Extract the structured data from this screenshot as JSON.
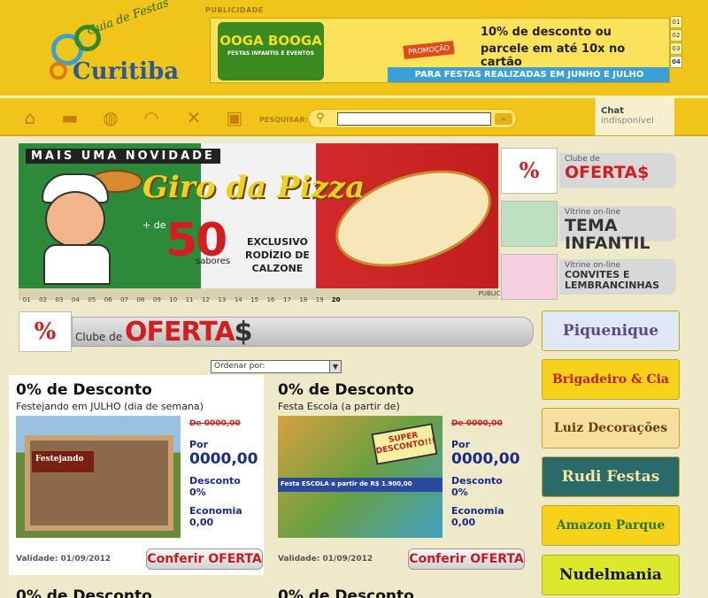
{
  "header": {
    "logo_top": "Guia de Festas",
    "logo_city": "Curitiba",
    "publicidade": "PUBLICIDADE"
  },
  "top_ad": {
    "brand": "OOGA BOOGA",
    "brand_sub": "FESTAS INFANTIS E EVENTOS",
    "promo": "PROMOÇÃO",
    "line1": "10% de desconto ou",
    "line2": "parcele em até 10x no cartão",
    "bottom": "PARA FESTAS REALIZADAS EM JUNHO E JULHO",
    "pages": [
      "01",
      "02",
      "03",
      "04"
    ],
    "active_page": "04"
  },
  "nav": {
    "icons": [
      "home-icon",
      "cake-icon",
      "plate-icon",
      "croissant-icon",
      "tools-icon",
      "gift-icon"
    ],
    "search_label": "PESQUISAR:",
    "search_value": "",
    "chat_title": "Chat",
    "chat_status": "indisponível"
  },
  "banner": {
    "tag": "MAIS UMA NOVIDADE",
    "title": "Giro da Pizza",
    "mais_de": "+ de",
    "fifty": "50",
    "sabores": "sabores",
    "exclusivo": "EXCLUSIVO",
    "rodizio": "RODÍZIO DE",
    "calzone": "CALZONE",
    "pages": [
      "01",
      "02",
      "03",
      "04",
      "05",
      "06",
      "07",
      "08",
      "09",
      "10",
      "11",
      "12",
      "13",
      "14",
      "15",
      "16",
      "17",
      "18",
      "19",
      "20"
    ],
    "active_page": "20",
    "publicidade": "PUBLICIDADE"
  },
  "side_tiles": [
    {
      "small": "Clube de",
      "big": "OFERTA$"
    },
    {
      "small": "Vitrine on-line",
      "big": "TEMA INFANTIL"
    },
    {
      "small": "Vitrine on-line",
      "mid1": "CONVITES E",
      "mid2": "LEMBRANCINHAS"
    }
  ],
  "clube": {
    "pct": "%",
    "label": "Clube de",
    "ofertas": "OFERTA",
    "dollar": "$"
  },
  "sort": {
    "label": "Ordenar por:"
  },
  "cards": [
    {
      "title": "0% de Desconto",
      "subtitle": "Festejando em JULHO (dia de semana)",
      "image_caption": "Festejando",
      "old_price": "De 0000,00",
      "por": "Por",
      "price": "0000,00",
      "desconto_label": "Desconto",
      "desconto": "0%",
      "economia_label": "Economia",
      "economia": "0,00",
      "validade": "Validade: 01/09/2012",
      "button": "Conferir OFERTA"
    },
    {
      "title": "0% de Desconto",
      "subtitle": "Festa Escola (a partir de)",
      "image_caption": "SUPER DESCONTO!!!",
      "image_banner": "Festa ESCOLA a partir de R$ 1.900,00",
      "old_price": "De 0000,00",
      "por": "Por",
      "price": "0000,00",
      "desconto_label": "Desconto",
      "desconto": "0%",
      "economia_label": "Economia",
      "economia": "0,00",
      "validade": "Validade: 01/09/2012",
      "button": "Conferir OFERTA"
    }
  ],
  "peek_titles": [
    "0% de Desconto",
    "0% de Desconto"
  ],
  "sponsors": [
    {
      "name": "Piquenique",
      "bg": "#dfe9f5",
      "color": "#5a4a8a"
    },
    {
      "name": "Brigadeiro & Cia",
      "bg": "#f7d21a",
      "color": "#c21e1e"
    },
    {
      "name": "Luiz Decorações",
      "bg": "#f5e0a0",
      "color": "#6a3a10"
    },
    {
      "name": "Rudi Festas",
      "bg": "#2a6a6a",
      "color": "#f5e6a0"
    },
    {
      "name": "Amazon Parque",
      "bg": "#f7d21a",
      "color": "#2a7a2a"
    },
    {
      "name": "Nudelmania",
      "bg": "#dce82a",
      "color": "#111111"
    }
  ]
}
